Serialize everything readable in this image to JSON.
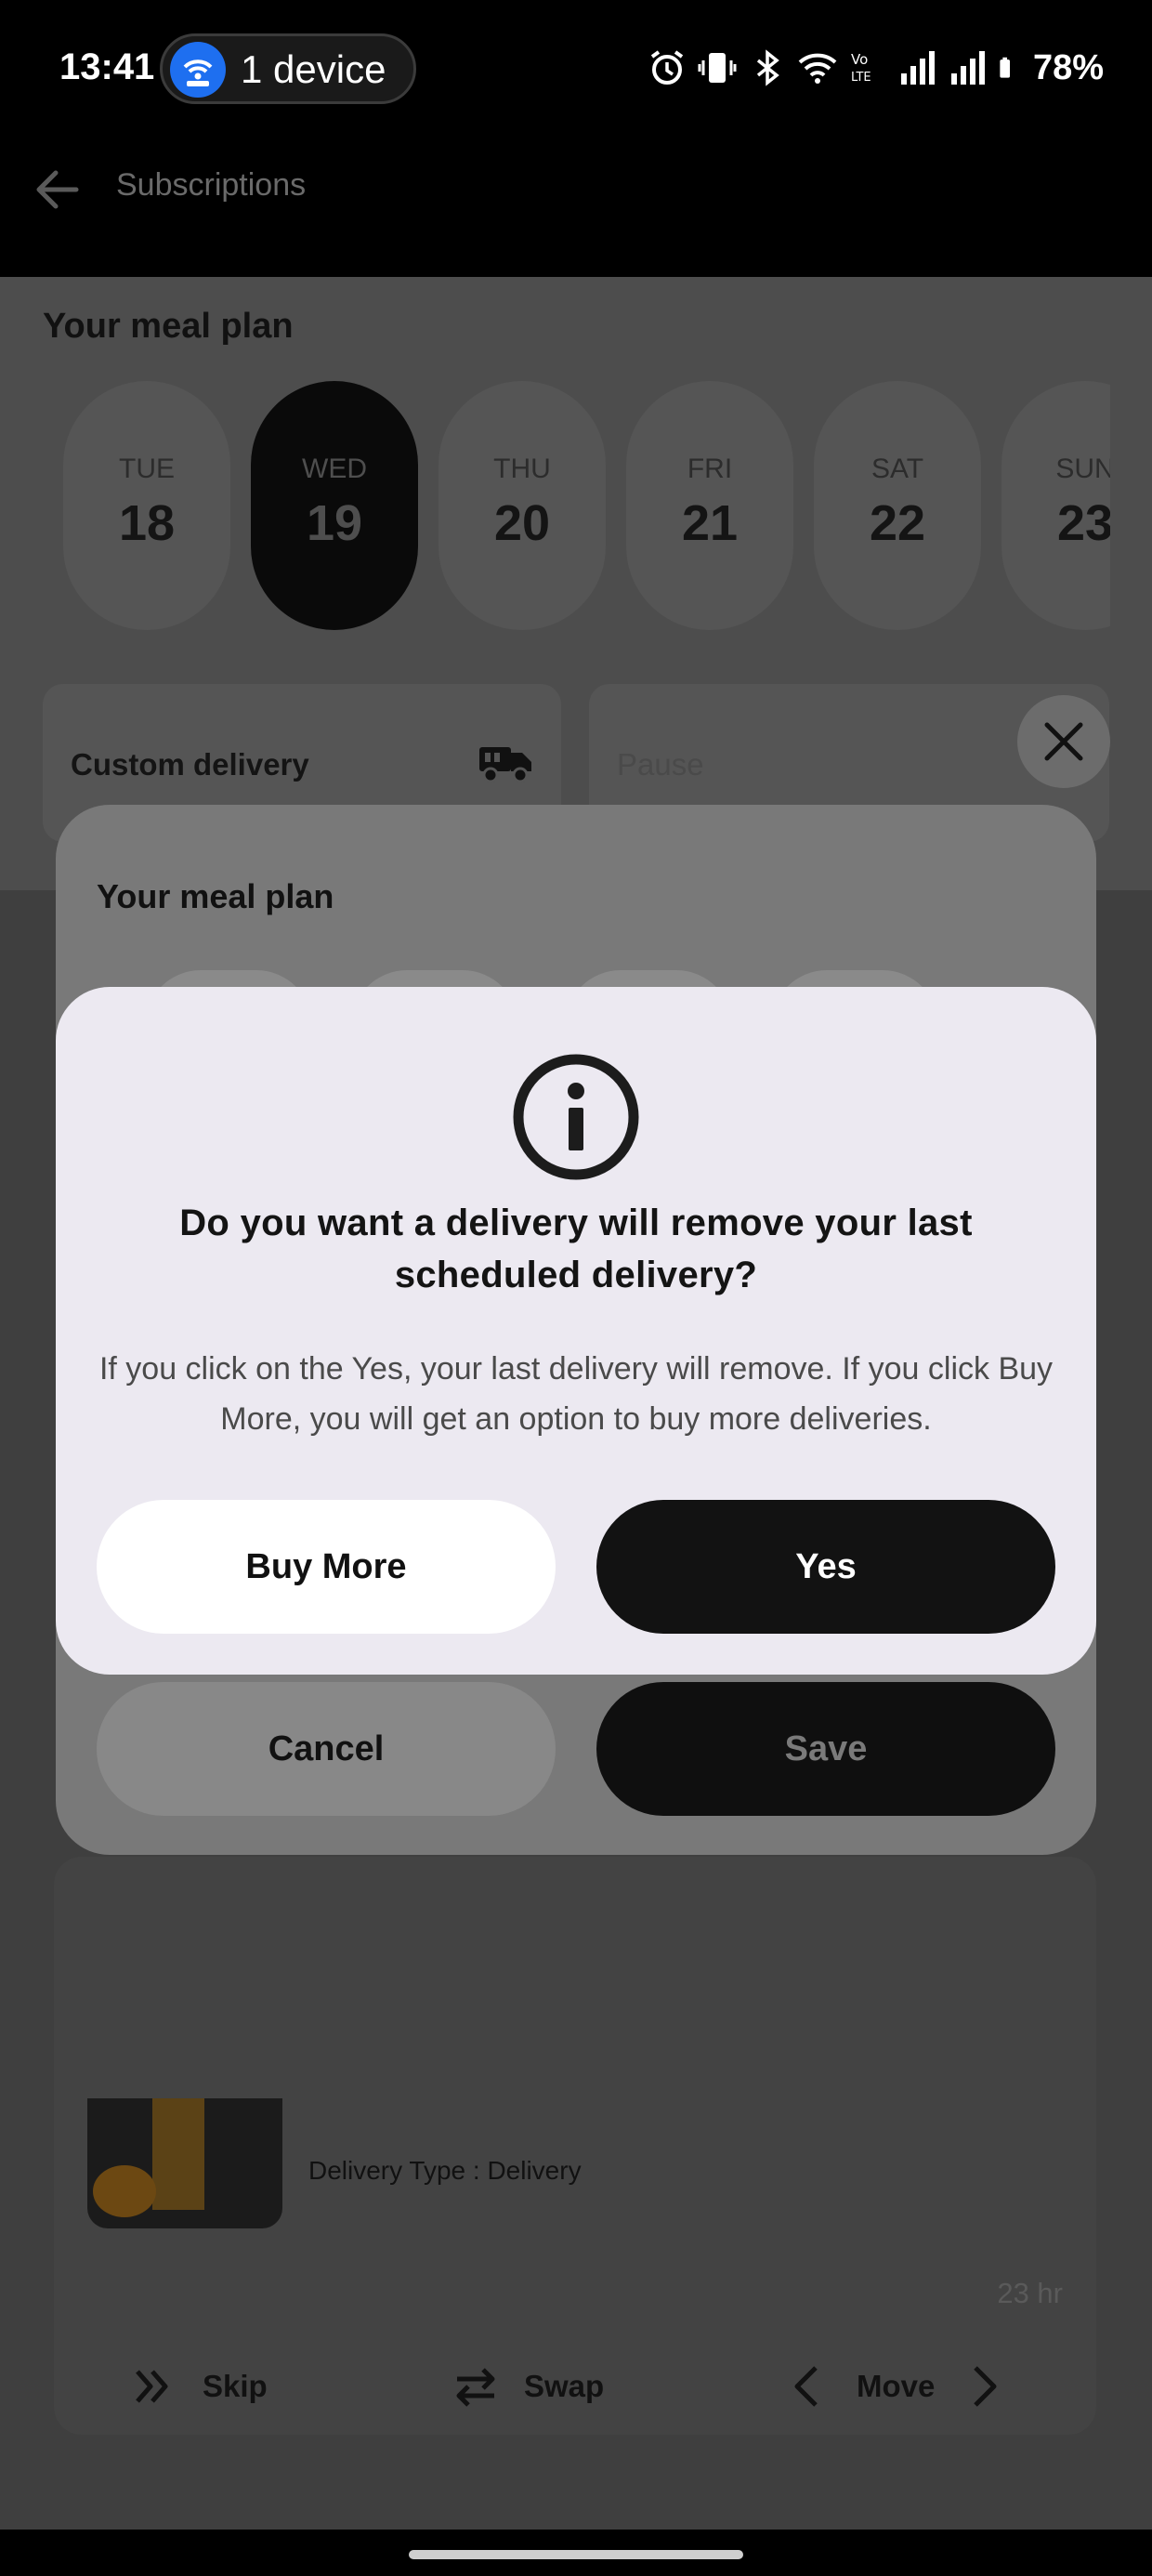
{
  "status_bar": {
    "time": "13:41",
    "device_pill": "1 device",
    "battery": "78%",
    "icons": [
      "alarm-icon",
      "vibrate-icon",
      "bluetooth-icon",
      "wifi-icon",
      "volte-icon",
      "signal-icon",
      "signal-icon",
      "battery-icon"
    ]
  },
  "app_bar": {
    "title": "Subscriptions",
    "back_icon": "arrow-left-icon"
  },
  "meal_plan": {
    "title": "Your meal plan",
    "days": [
      {
        "name": "TUE",
        "num": "18",
        "selected": false
      },
      {
        "name": "WED",
        "num": "19",
        "selected": true
      },
      {
        "name": "THU",
        "num": "20",
        "selected": false
      },
      {
        "name": "FRI",
        "num": "21",
        "selected": false
      },
      {
        "name": "SAT",
        "num": "22",
        "selected": false
      },
      {
        "name": "SUN",
        "num": "23",
        "selected": false
      }
    ],
    "custom_delivery": "Custom delivery",
    "pause": "Pause"
  },
  "list_card": {
    "delivery_type": "Delivery Type : Delivery",
    "time_left": "23 hr",
    "actions": {
      "skip": "Skip",
      "swap": "Swap",
      "move": "Move"
    }
  },
  "sheet": {
    "title": "Your meal plan",
    "cancel": "Cancel",
    "save": "Save"
  },
  "dialog": {
    "title": "Do you want a delivery will remove your last scheduled delivery?",
    "body": "If you click on the Yes, your last delivery will remove. If you click Buy More, you will get an option to buy more deliveries.",
    "buy_more": "Buy More",
    "yes": "Yes"
  }
}
